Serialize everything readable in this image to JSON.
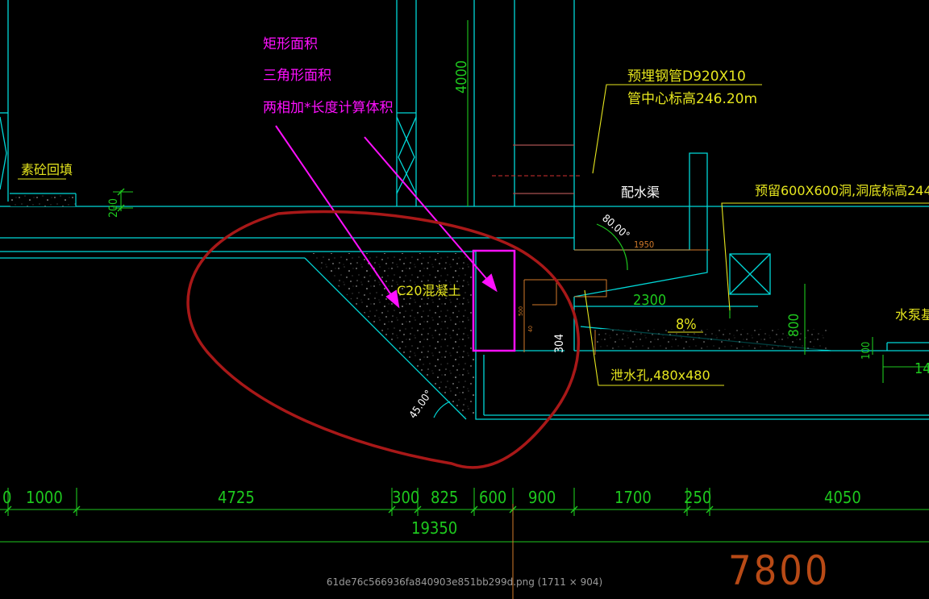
{
  "annotations": {
    "rect_area": "矩形面积",
    "triangle_area": "三角形面积",
    "sum_times_length": "两相加*长度计算体积"
  },
  "labels": {
    "backfill": "素砼回填",
    "pipe_spec": "预埋钢管D920X10",
    "pipe_center": "管中心标高246.20m",
    "channel": "配水渠",
    "reserved_hole": "预留600X600洞,洞底标高244",
    "concrete": "C20混凝土",
    "drain_hole": "泄水孔,480x480",
    "pump": "水泵基",
    "slope": "8%"
  },
  "dims": {
    "h4000": "4000",
    "h200": "200",
    "angle80": "80.00°",
    "w1950": "1950",
    "w2300": "2300",
    "h800": "800",
    "h100": "100",
    "w14": "14",
    "h304": "304",
    "angle45": "45.00°",
    "small_a": "500",
    "small_b": "40",
    "bottom": [
      "0",
      "1000",
      "4725",
      "300",
      "825",
      "600",
      "900",
      "1700",
      "250",
      "4050"
    ],
    "total": "19350",
    "big": "7800"
  },
  "caption": "61de76c566936fa840903e851bb299d.png (1711 × 904)",
  "colors": {
    "background": "#000000",
    "cyan": "#00d8d8",
    "yellow": "#e6e61e",
    "green": "#1ec81e",
    "magenta": "#ff10ff",
    "red_circle": "#a81818",
    "dim_orange": "#d27a2a",
    "white": "#ffffff",
    "big_text": "#b84a16"
  }
}
